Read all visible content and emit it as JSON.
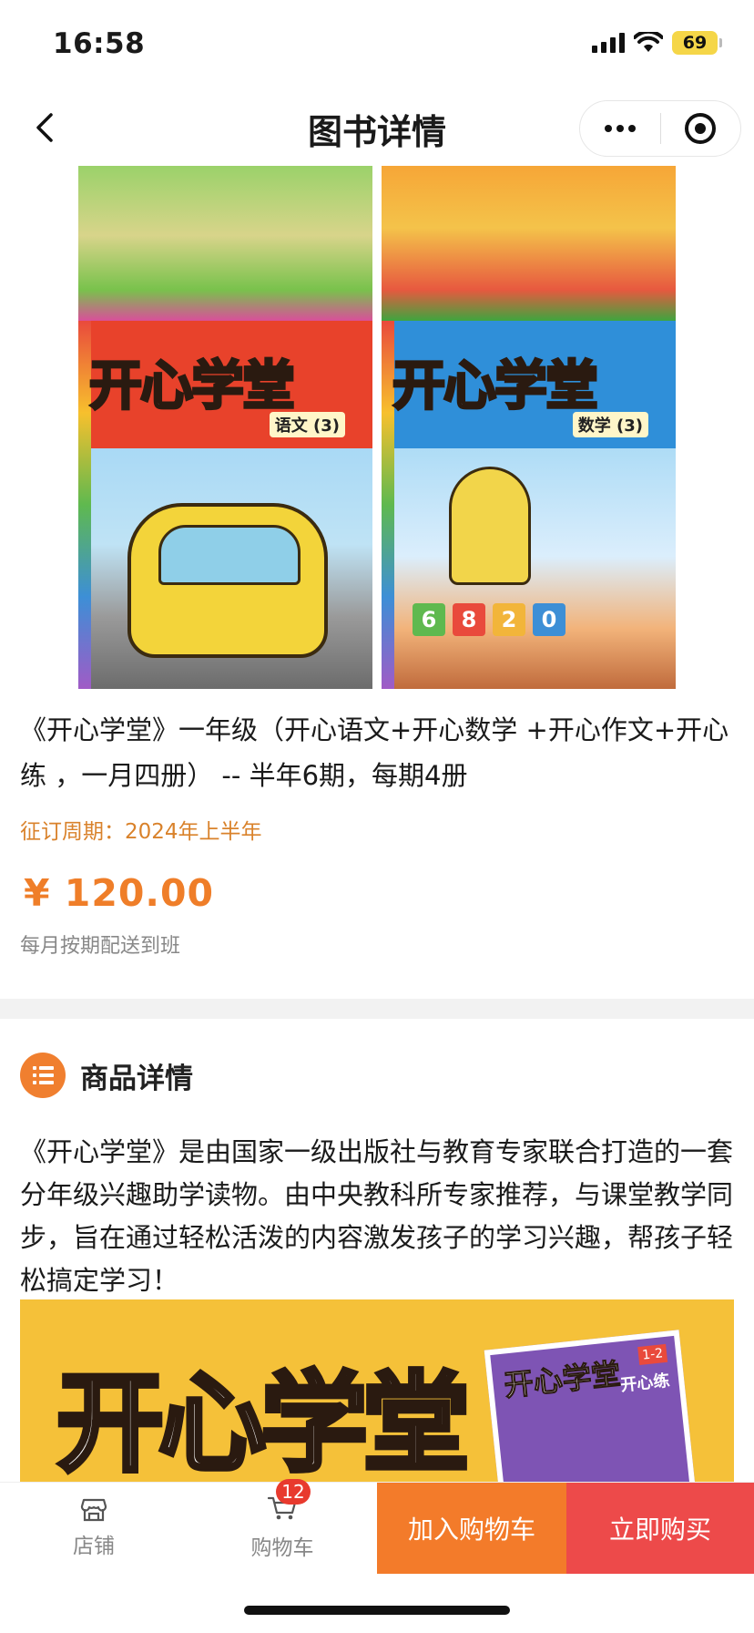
{
  "status_bar": {
    "time": "16:58",
    "battery": "69"
  },
  "nav": {
    "title": "图书详情"
  },
  "covers": {
    "brand": "开心学堂",
    "left_subject": "语文 (3)",
    "right_subject": "数学 (3)",
    "numbers": [
      "6",
      "8",
      "2",
      "0"
    ]
  },
  "product": {
    "title": "《开心学堂》一年级（开心语文+开心数学 +开心作文+开心练 ，一月四册） -- 半年6期，每期4册",
    "subscribe_period": "征订周期：2024年上半年",
    "price": "¥ 120.00",
    "delivery_note": "每月按期配送到班"
  },
  "details": {
    "section_title": "商品详情",
    "description": "《开心学堂》是由国家一级出版社与教育专家联合打造的一套分年级兴趣助学读物。由中央教科所专家推荐，与课堂教学同步，旨在通过轻松活泼的内容激发孩子的学习兴趣，帮孩子轻松搞定学习！",
    "banner_title": "开心学堂",
    "banner_book_title": "开心学堂",
    "banner_book_grade": "1-2",
    "banner_book_sub": "开心练"
  },
  "bottom_bar": {
    "shop_label": "店铺",
    "cart_label": "购物车",
    "cart_count": "12",
    "add_to_cart_label": "加入购物车",
    "buy_now_label": "立即购买"
  },
  "colors": {
    "accent_orange": "#f37b2a",
    "buy_red": "#ed4a4a",
    "price_orange": "#ef7e29",
    "period_orange": "#d9822b"
  }
}
